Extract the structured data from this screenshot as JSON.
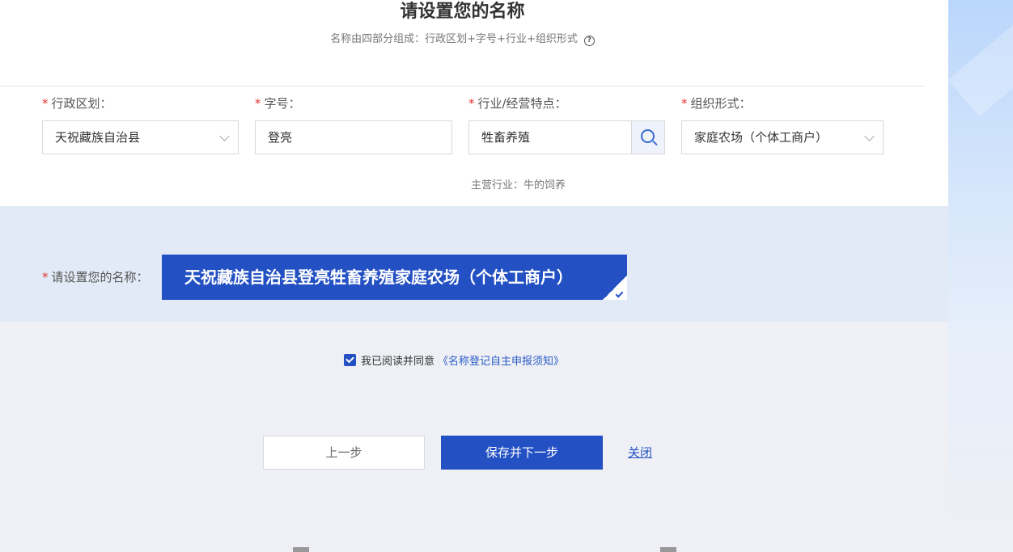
{
  "header": {
    "title": "请设置您的名称",
    "subtitle": "名称由四部分组成：行政区划+字号+行业+组织形式",
    "help_icon": "question-circle-icon"
  },
  "fields": {
    "region": {
      "label": "行政区划：",
      "value": "天祝藏族自治县"
    },
    "trade_name": {
      "label": "字号：",
      "value": "登亮"
    },
    "industry": {
      "label": "行业/经营特点：",
      "value": "牲畜养殖",
      "hint": "主营行业：牛的饲养"
    },
    "org_form": {
      "label": "组织形式：",
      "value": "家庭农场（个体工商户）"
    }
  },
  "name_section": {
    "label": "请设置您的名称：",
    "full_name": "天祝藏族自治县登亮牲畜养殖家庭农场（个体工商户）"
  },
  "agreement": {
    "checked": true,
    "text": "我已阅读并同意",
    "link": "《名称登记自主申报须知》"
  },
  "actions": {
    "prev": "上一步",
    "save_next": "保存并下一步",
    "close": "关闭"
  },
  "colors": {
    "primary": "#2350c3",
    "required": "#e5322d",
    "band": "#e2eaf7"
  }
}
